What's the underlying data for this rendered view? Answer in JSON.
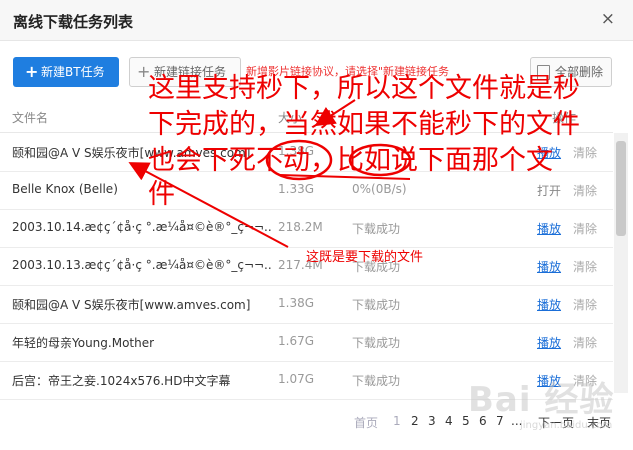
{
  "dialog": {
    "title": "离线下载任务列表",
    "close_label": "×"
  },
  "toolbar": {
    "new_bt_label": "新建BT任务",
    "new_link_label": "新建链接任务",
    "clear_all_label": "全部删除",
    "tip_text": "新增影片链接协议，请选择\"新建链接任务"
  },
  "table": {
    "headers": {
      "name": "文件名",
      "size": "大小",
      "status": "",
      "actions": "操作"
    },
    "rows": [
      {
        "name": "颐和园@A V S娱乐夜市[www.amves.com]",
        "size": "1.38G",
        "status": "",
        "action1": "播放",
        "action2": "清除"
      },
      {
        "name": "Belle Knox (Belle)",
        "size": "1.33G",
        "status": "0%(0B/s)",
        "action1": "打开",
        "action2": "清除"
      },
      {
        "name": "2003.10.14.æ¢ç´¢å·ç °.æ¼å¤©è®°_ç¬¬...",
        "size": "218.2M",
        "status": "下载成功",
        "action1": "播放",
        "action2": "清除"
      },
      {
        "name": "2003.10.13.æ¢ç´¢å·ç °.æ¼å¤©è®°_ç¬¬...",
        "size": "217.4M",
        "status": "下载成功",
        "action1": "播放",
        "action2": "清除"
      },
      {
        "name": "颐和园@A V S娱乐夜市[www.amves.com]",
        "size": "1.38G",
        "status": "下载成功",
        "action1": "播放",
        "action2": "清除"
      },
      {
        "name": "年轻的母亲Young.Mother",
        "size": "1.67G",
        "status": "下载成功",
        "action1": "播放",
        "action2": "清除"
      },
      {
        "name": "后宫：帝王之妾.1024x576.HD中文字幕",
        "size": "1.07G",
        "status": "下载成功",
        "action1": "播放",
        "action2": "清除"
      }
    ]
  },
  "pager": {
    "first": "首页",
    "pages": [
      "1",
      "2",
      "3",
      "4",
      "5",
      "6",
      "7"
    ],
    "ellipsis": "...",
    "next": "下一页",
    "last": "末页"
  },
  "annotations": {
    "line1": "这里支持秒下，所以这个文件就是秒",
    "line2": "下完成的，当然如果不能秒下的文件",
    "line3": "也会下死不动，比如说下面那个文",
    "line4": "件",
    "arrow_note": "这既是要下载的文件"
  },
  "watermark": {
    "text": "Bai 经验",
    "sub": "jingyan.baidu.com"
  },
  "colors": {
    "accent": "#1f7ee0",
    "link": "#1a6ed8",
    "annotation": "#ee0000"
  }
}
